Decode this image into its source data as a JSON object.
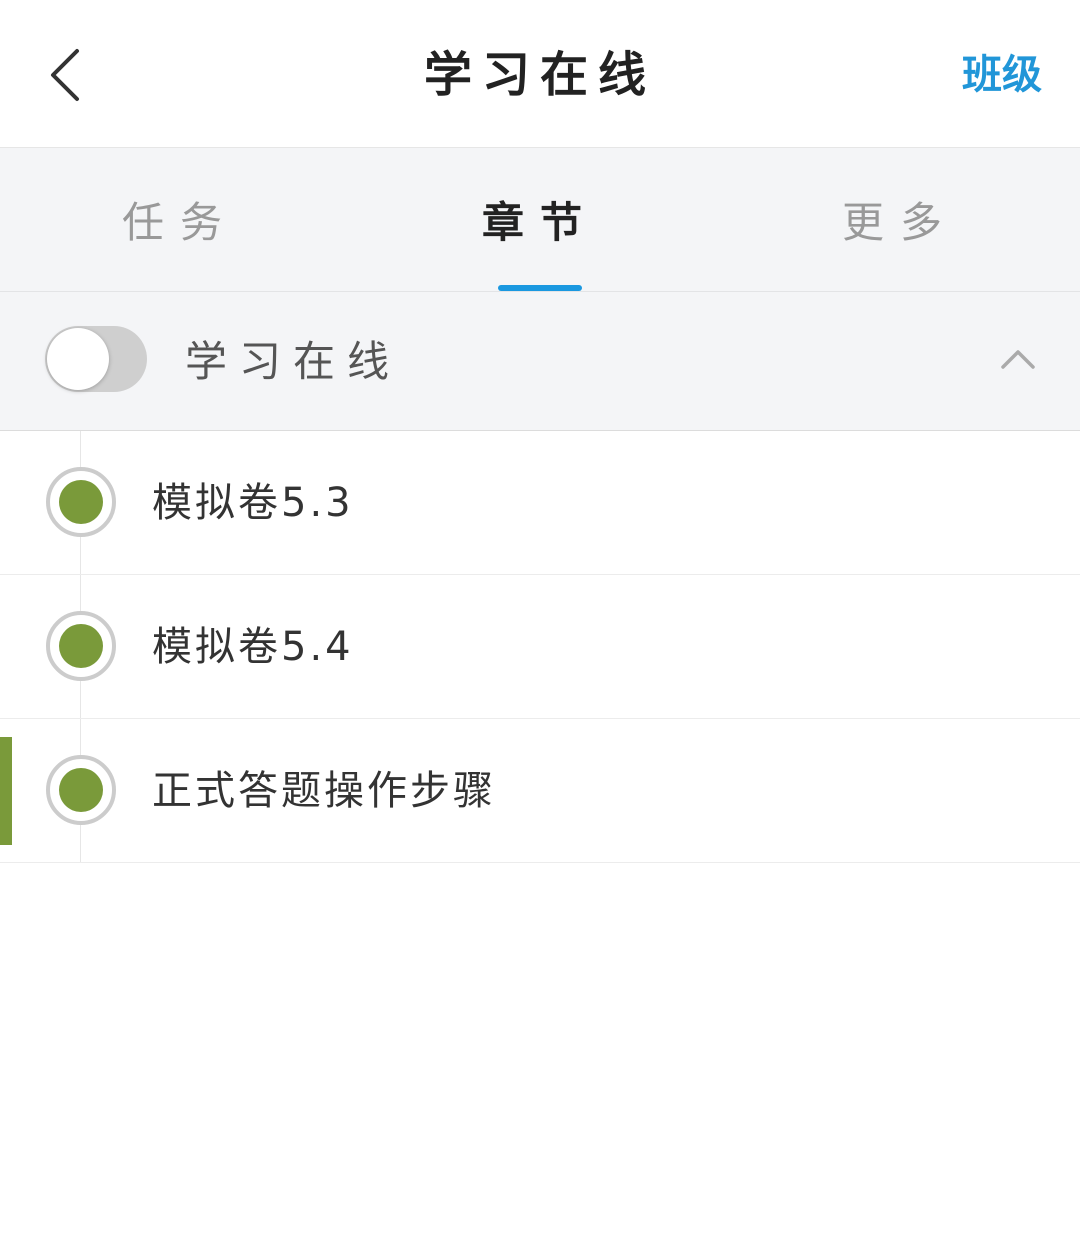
{
  "colors": {
    "accent": "#2196d8",
    "indicator": "#1a98e0",
    "status_dot": "#7a9a3a"
  },
  "nav": {
    "back_icon": "chevron-left-icon",
    "title": "学习在线",
    "right_action": "班级"
  },
  "tabs": [
    {
      "label": "任务",
      "active": false
    },
    {
      "label": "章节",
      "active": true
    },
    {
      "label": "更多",
      "active": false
    }
  ],
  "chapter": {
    "toggle_on": false,
    "title": "学习在线",
    "collapse_icon": "chevron-up-icon"
  },
  "items": [
    {
      "label": "模拟卷5.3",
      "status": "completed"
    },
    {
      "label": "模拟卷5.4",
      "status": "completed"
    },
    {
      "label": "正式答题操作步骤",
      "status": "completed",
      "current": true
    }
  ]
}
